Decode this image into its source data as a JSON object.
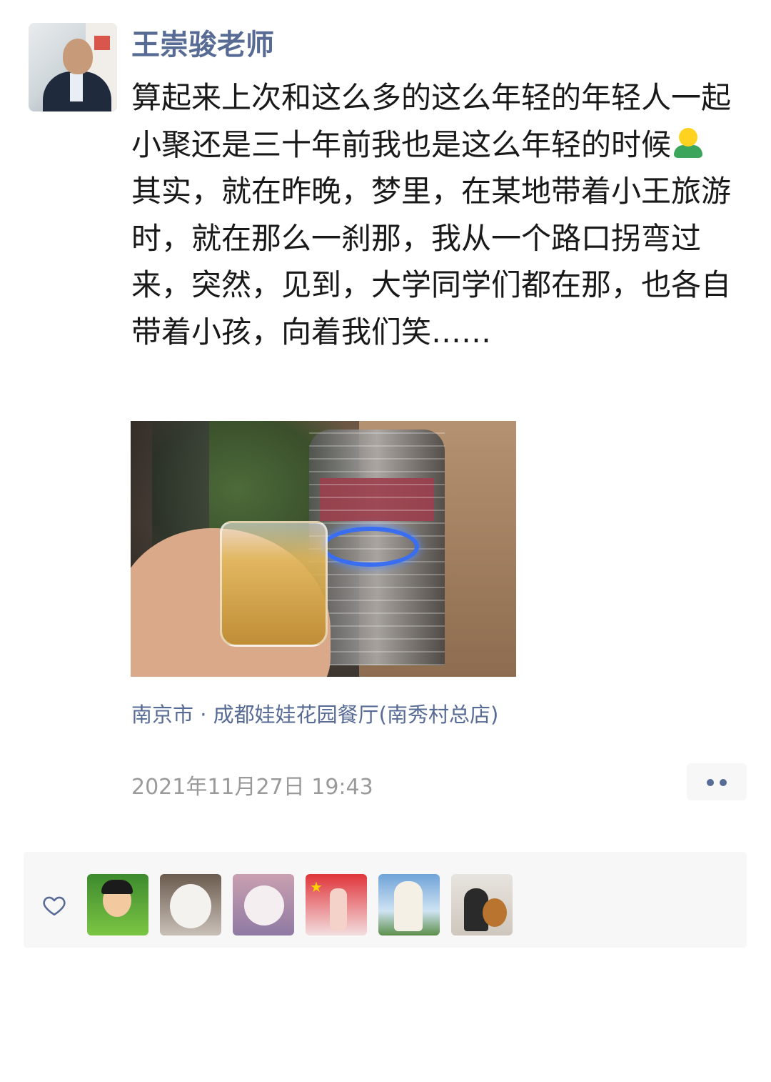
{
  "post": {
    "author": "王崇骏老师",
    "paragraphs": [
      "算起来上次和这么多的这么年轻的年轻人一起小聚还是三十年前我也是这么年轻的时候",
      "其实，就在昨晚，梦里，在某地带着小王旅游时，就在那么一刹那，我从一个路口拐弯过来，突然，见到，大学同学们都在那，也各自带着小孩，向着我们笑……"
    ],
    "emoji_icon": "person-standing-emoji",
    "image_description_icon": "drink-glass-photo",
    "location": "南京市 · 成都娃娃花园餐厅(南秀村总店)",
    "timestamp": "2021年11月27日 19:43"
  },
  "likes": {
    "icon": "heart-outline-icon",
    "avatars": [
      "liker-avatar-1",
      "liker-avatar-2",
      "liker-avatar-3",
      "liker-avatar-4",
      "liker-avatar-5",
      "liker-avatar-6"
    ]
  },
  "colors": {
    "author_name": "#576b95",
    "location": "#576b95",
    "timestamp": "#9a9a9a",
    "like_panel_bg": "#f7f7f7"
  }
}
